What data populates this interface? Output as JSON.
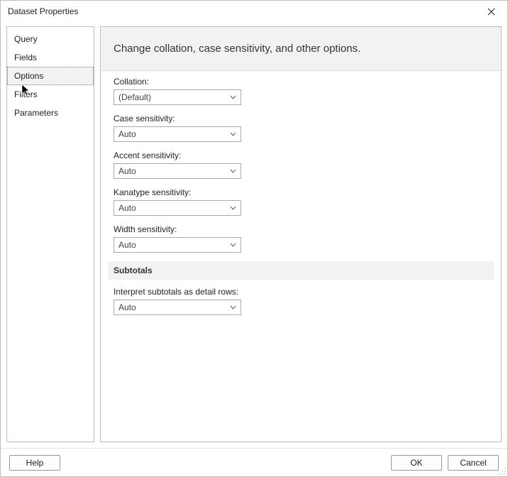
{
  "dialog": {
    "title": "Dataset Properties"
  },
  "sidebar": {
    "items": [
      {
        "label": "Query"
      },
      {
        "label": "Fields"
      },
      {
        "label": "Options"
      },
      {
        "label": "Filters"
      },
      {
        "label": "Parameters"
      }
    ],
    "selected_index": 2
  },
  "main": {
    "heading": "Change collation, case sensitivity, and other options.",
    "fields": [
      {
        "label": "Collation:",
        "value": "(Default)"
      },
      {
        "label": "Case sensitivity:",
        "value": "Auto"
      },
      {
        "label": "Accent sensitivity:",
        "value": "Auto"
      },
      {
        "label": "Kanatype sensitivity:",
        "value": "Auto"
      },
      {
        "label": "Width sensitivity:",
        "value": "Auto"
      }
    ],
    "subtotals": {
      "section_label": "Subtotals",
      "field": {
        "label": "Interpret subtotals as detail rows:",
        "value": "Auto"
      }
    }
  },
  "footer": {
    "help": "Help",
    "ok": "OK",
    "cancel": "Cancel"
  }
}
